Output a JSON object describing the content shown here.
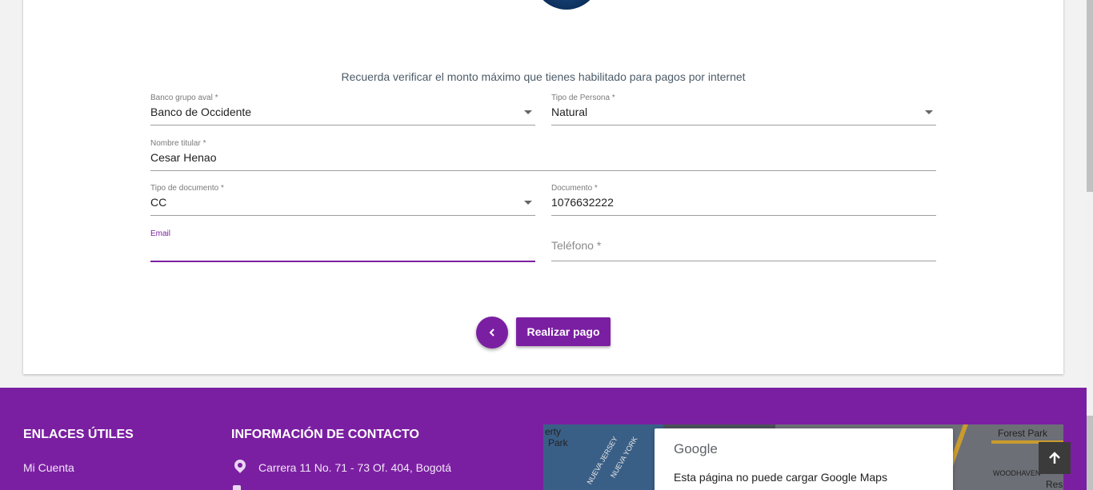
{
  "form": {
    "notice": "Recuerda verificar el monto máximo que tienes habilitado para pagos por internet",
    "bank": {
      "label": "Banco grupo aval *",
      "value": "Banco de Occidente"
    },
    "person_type": {
      "label": "Tipo de Persona *",
      "value": "Natural"
    },
    "holder_name": {
      "label": "Nombre titular *",
      "value": "Cesar Henao"
    },
    "doc_type": {
      "label": "Tipo de documento *",
      "value": "CC"
    },
    "document": {
      "label": "Documento *",
      "value": "1076632222"
    },
    "email": {
      "label": "Email",
      "value": ""
    },
    "phone": {
      "placeholder": "Teléfono *",
      "value": ""
    },
    "back_icon": "chevron-left-icon",
    "submit_label": "Realizar pago",
    "accent_color": "#7b1fa2"
  },
  "footer": {
    "links_title": "ENLACES ÚTILES",
    "links": [
      "Mi Cuenta"
    ],
    "contact_title": "INFORMACIÓN DE CONTACTO",
    "address": "Carrera 11 No. 71 - 73 Of. 404, Bogotá",
    "background_color": "#7b1fa2"
  },
  "map": {
    "google_logo": "Google",
    "error_message": "Esta página no puede cargar Google Maps",
    "labels": [
      "Forest Park",
      "WOODHAVEN",
      "NUEVA JERSEY",
      "NUEVA YORK",
      "erty",
      "Park",
      "Res"
    ]
  },
  "scroll_top_icon": "arrow-up-icon"
}
